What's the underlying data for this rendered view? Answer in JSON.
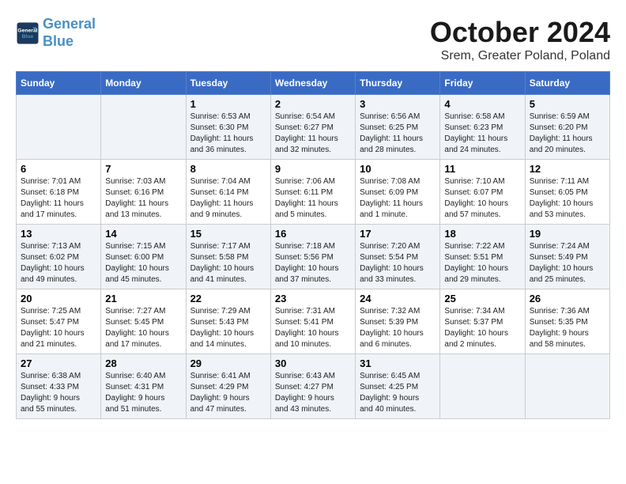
{
  "logo": {
    "line1": "General",
    "line2": "Blue"
  },
  "title": "October 2024",
  "location": "Srem, Greater Poland, Poland",
  "days_of_week": [
    "Sunday",
    "Monday",
    "Tuesday",
    "Wednesday",
    "Thursday",
    "Friday",
    "Saturday"
  ],
  "weeks": [
    [
      {
        "day": "",
        "info": ""
      },
      {
        "day": "",
        "info": ""
      },
      {
        "day": "1",
        "info": "Sunrise: 6:53 AM\nSunset: 6:30 PM\nDaylight: 11 hours\nand 36 minutes."
      },
      {
        "day": "2",
        "info": "Sunrise: 6:54 AM\nSunset: 6:27 PM\nDaylight: 11 hours\nand 32 minutes."
      },
      {
        "day": "3",
        "info": "Sunrise: 6:56 AM\nSunset: 6:25 PM\nDaylight: 11 hours\nand 28 minutes."
      },
      {
        "day": "4",
        "info": "Sunrise: 6:58 AM\nSunset: 6:23 PM\nDaylight: 11 hours\nand 24 minutes."
      },
      {
        "day": "5",
        "info": "Sunrise: 6:59 AM\nSunset: 6:20 PM\nDaylight: 11 hours\nand 20 minutes."
      }
    ],
    [
      {
        "day": "6",
        "info": "Sunrise: 7:01 AM\nSunset: 6:18 PM\nDaylight: 11 hours\nand 17 minutes."
      },
      {
        "day": "7",
        "info": "Sunrise: 7:03 AM\nSunset: 6:16 PM\nDaylight: 11 hours\nand 13 minutes."
      },
      {
        "day": "8",
        "info": "Sunrise: 7:04 AM\nSunset: 6:14 PM\nDaylight: 11 hours\nand 9 minutes."
      },
      {
        "day": "9",
        "info": "Sunrise: 7:06 AM\nSunset: 6:11 PM\nDaylight: 11 hours\nand 5 minutes."
      },
      {
        "day": "10",
        "info": "Sunrise: 7:08 AM\nSunset: 6:09 PM\nDaylight: 11 hours\nand 1 minute."
      },
      {
        "day": "11",
        "info": "Sunrise: 7:10 AM\nSunset: 6:07 PM\nDaylight: 10 hours\nand 57 minutes."
      },
      {
        "day": "12",
        "info": "Sunrise: 7:11 AM\nSunset: 6:05 PM\nDaylight: 10 hours\nand 53 minutes."
      }
    ],
    [
      {
        "day": "13",
        "info": "Sunrise: 7:13 AM\nSunset: 6:02 PM\nDaylight: 10 hours\nand 49 minutes."
      },
      {
        "day": "14",
        "info": "Sunrise: 7:15 AM\nSunset: 6:00 PM\nDaylight: 10 hours\nand 45 minutes."
      },
      {
        "day": "15",
        "info": "Sunrise: 7:17 AM\nSunset: 5:58 PM\nDaylight: 10 hours\nand 41 minutes."
      },
      {
        "day": "16",
        "info": "Sunrise: 7:18 AM\nSunset: 5:56 PM\nDaylight: 10 hours\nand 37 minutes."
      },
      {
        "day": "17",
        "info": "Sunrise: 7:20 AM\nSunset: 5:54 PM\nDaylight: 10 hours\nand 33 minutes."
      },
      {
        "day": "18",
        "info": "Sunrise: 7:22 AM\nSunset: 5:51 PM\nDaylight: 10 hours\nand 29 minutes."
      },
      {
        "day": "19",
        "info": "Sunrise: 7:24 AM\nSunset: 5:49 PM\nDaylight: 10 hours\nand 25 minutes."
      }
    ],
    [
      {
        "day": "20",
        "info": "Sunrise: 7:25 AM\nSunset: 5:47 PM\nDaylight: 10 hours\nand 21 minutes."
      },
      {
        "day": "21",
        "info": "Sunrise: 7:27 AM\nSunset: 5:45 PM\nDaylight: 10 hours\nand 17 minutes."
      },
      {
        "day": "22",
        "info": "Sunrise: 7:29 AM\nSunset: 5:43 PM\nDaylight: 10 hours\nand 14 minutes."
      },
      {
        "day": "23",
        "info": "Sunrise: 7:31 AM\nSunset: 5:41 PM\nDaylight: 10 hours\nand 10 minutes."
      },
      {
        "day": "24",
        "info": "Sunrise: 7:32 AM\nSunset: 5:39 PM\nDaylight: 10 hours\nand 6 minutes."
      },
      {
        "day": "25",
        "info": "Sunrise: 7:34 AM\nSunset: 5:37 PM\nDaylight: 10 hours\nand 2 minutes."
      },
      {
        "day": "26",
        "info": "Sunrise: 7:36 AM\nSunset: 5:35 PM\nDaylight: 9 hours\nand 58 minutes."
      }
    ],
    [
      {
        "day": "27",
        "info": "Sunrise: 6:38 AM\nSunset: 4:33 PM\nDaylight: 9 hours\nand 55 minutes."
      },
      {
        "day": "28",
        "info": "Sunrise: 6:40 AM\nSunset: 4:31 PM\nDaylight: 9 hours\nand 51 minutes."
      },
      {
        "day": "29",
        "info": "Sunrise: 6:41 AM\nSunset: 4:29 PM\nDaylight: 9 hours\nand 47 minutes."
      },
      {
        "day": "30",
        "info": "Sunrise: 6:43 AM\nSunset: 4:27 PM\nDaylight: 9 hours\nand 43 minutes."
      },
      {
        "day": "31",
        "info": "Sunrise: 6:45 AM\nSunset: 4:25 PM\nDaylight: 9 hours\nand 40 minutes."
      },
      {
        "day": "",
        "info": ""
      },
      {
        "day": "",
        "info": ""
      }
    ]
  ]
}
